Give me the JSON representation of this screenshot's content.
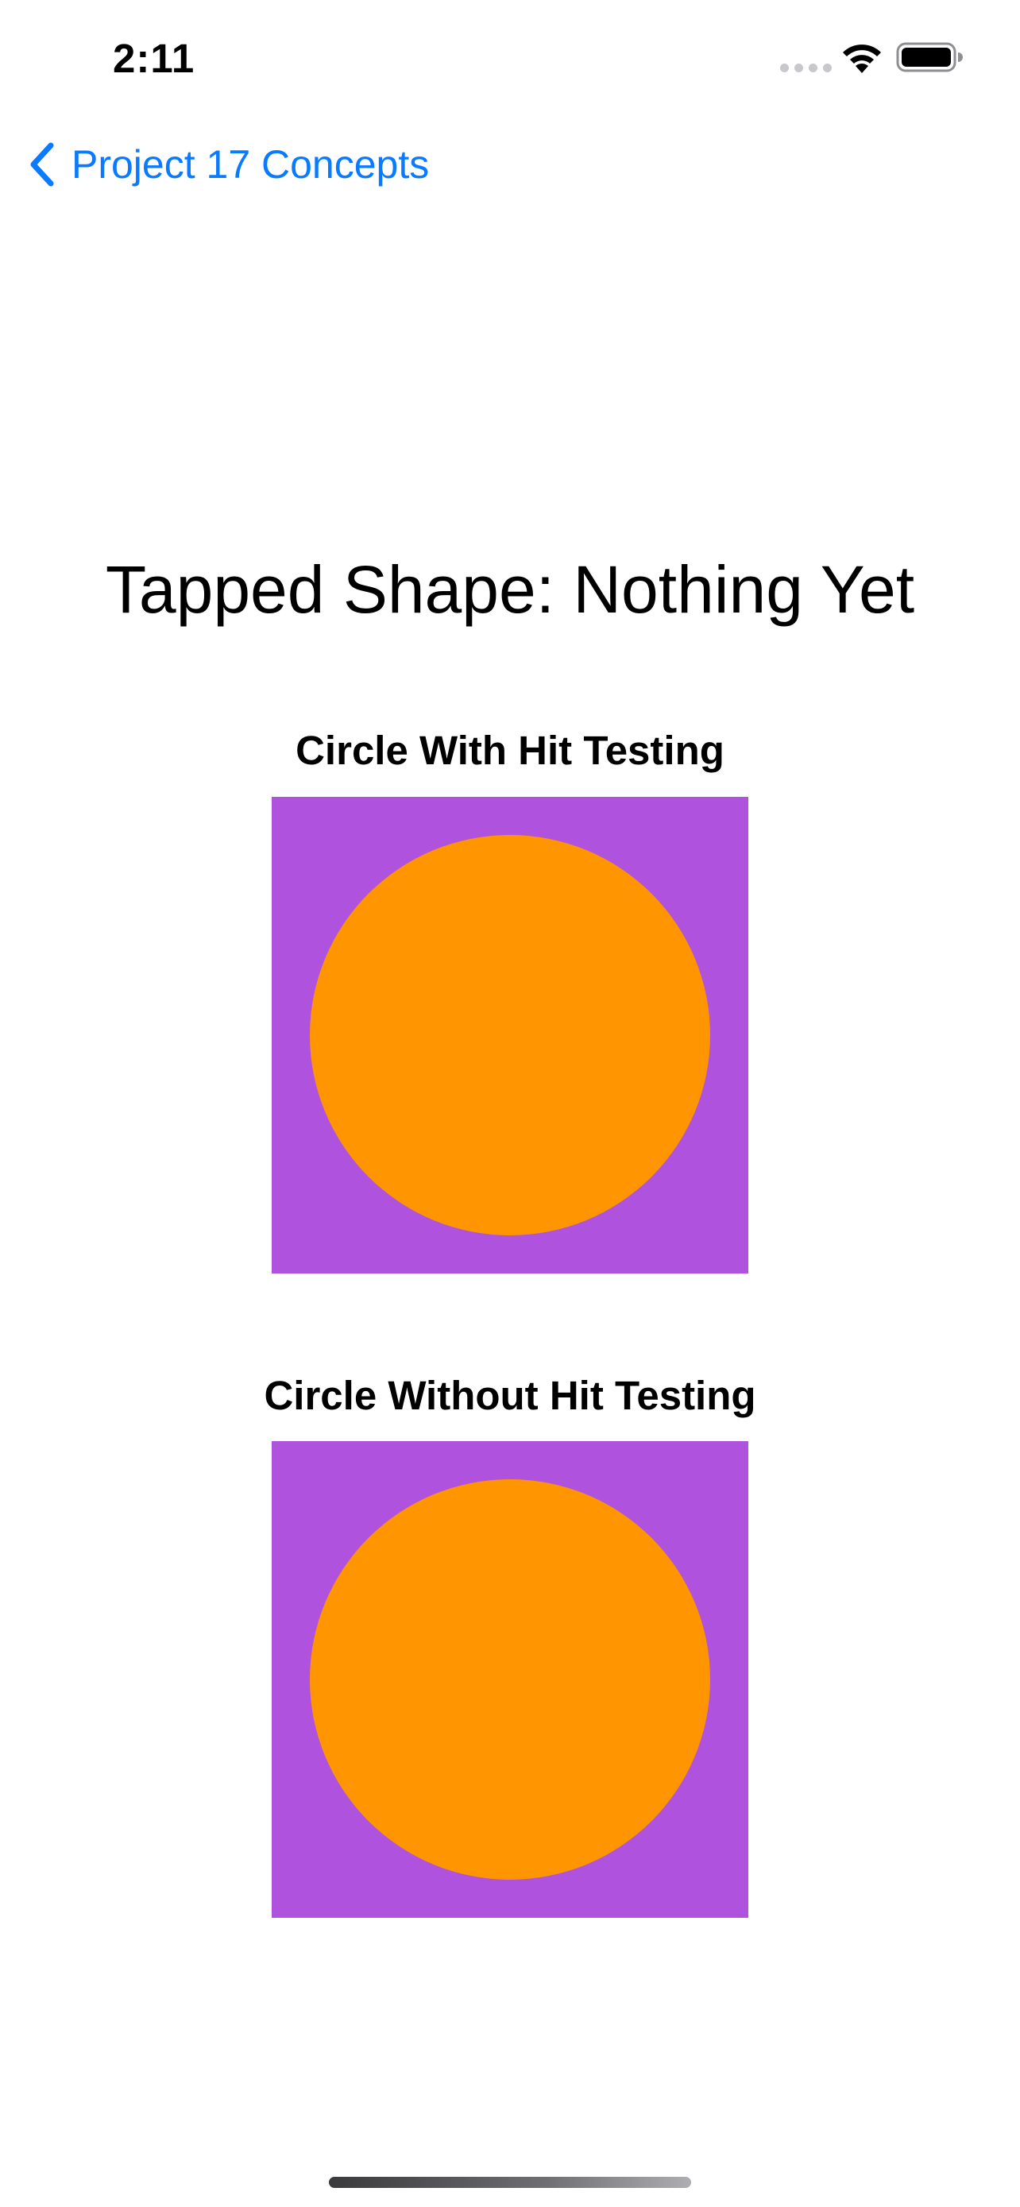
{
  "status_bar": {
    "time": "2:11",
    "icons": [
      "cellular-dots-icon",
      "wifi-icon",
      "battery-icon"
    ]
  },
  "nav": {
    "back_label": "Project 17 Concepts",
    "back_icon": "chevron-left-icon"
  },
  "main": {
    "tapped_text": "Tapped Shape: Nothing Yet",
    "shapes": [
      {
        "label": "Circle With Hit Testing"
      },
      {
        "label": "Circle Without Hit Testing"
      }
    ]
  },
  "colors": {
    "accent": "#0a7aff",
    "shape_background": "#af52de",
    "circle_fill": "#ff9500"
  }
}
